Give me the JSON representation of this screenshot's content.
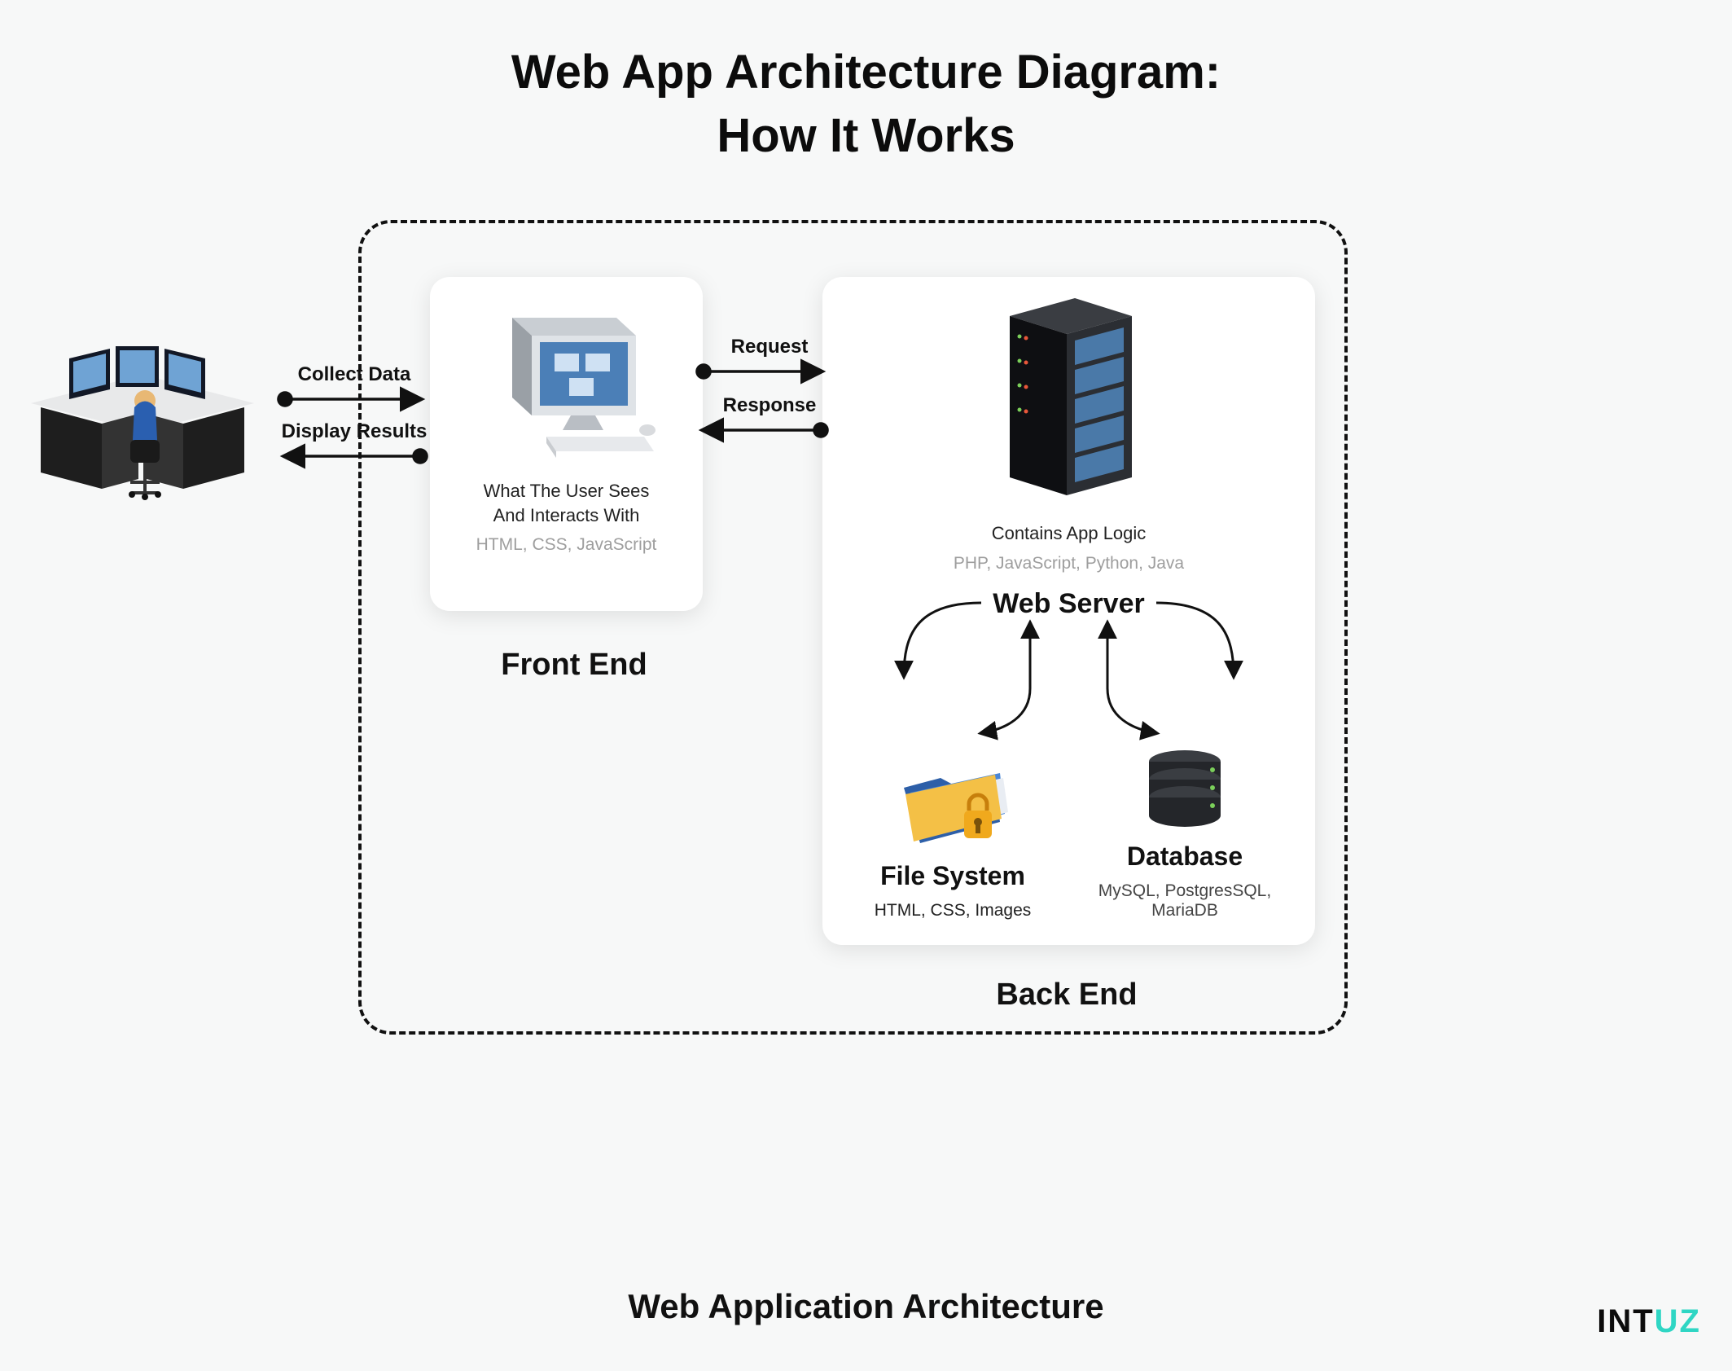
{
  "title_line1": "Web App Architecture Diagram:",
  "title_line2": "How It Works",
  "architecture_label": "Web Application Architecture",
  "frontend": {
    "label": "Front End",
    "description_line1": "What The User Sees",
    "description_line2": "And Interacts With",
    "technologies": "HTML, CSS, JavaScript"
  },
  "backend": {
    "label": "Back End",
    "server_description": "Contains App Logic",
    "server_technologies": "PHP, JavaScript, Python, Java",
    "web_server_label": "Web Server",
    "file_system": {
      "title": "File System",
      "contents": "HTML, CSS, Images"
    },
    "database": {
      "title": "Database",
      "technologies": "MySQL, PostgresSQL, MariaDB"
    }
  },
  "flows": {
    "user_to_front_top": "Collect Data",
    "user_to_front_bottom": "Display Results",
    "front_to_back_top": "Request",
    "front_to_back_bottom": "Response"
  },
  "brand": "INTUZ"
}
